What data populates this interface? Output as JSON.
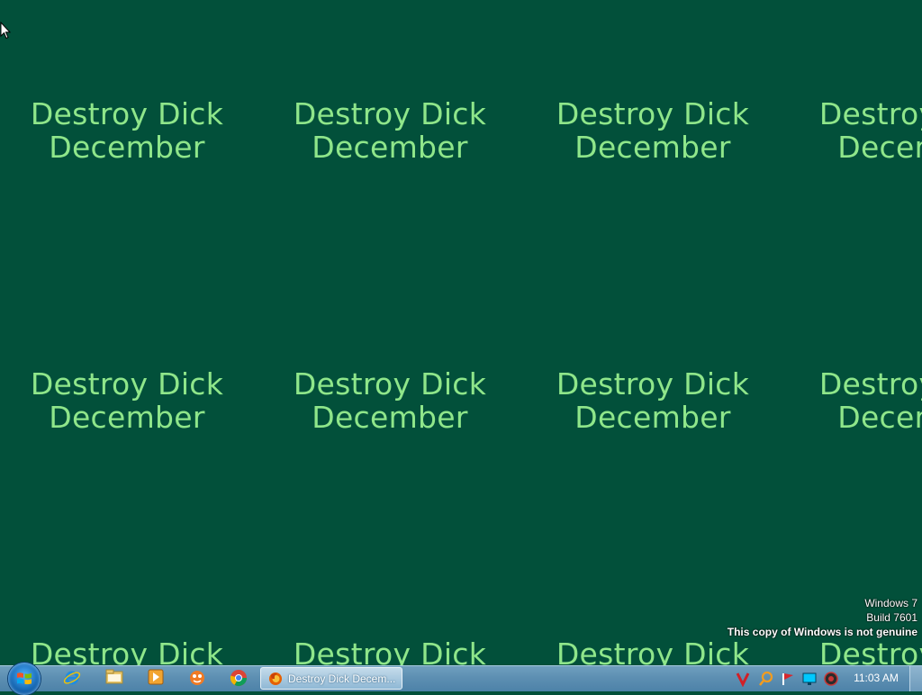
{
  "wallpaper": {
    "line1": "Destroy Dick",
    "line2": "December",
    "background": "#02503a",
    "text_color": "#8fe68a"
  },
  "watermark": {
    "os": "Windows 7",
    "build": "Build 7601",
    "notice": "This copy of Windows is not genuine"
  },
  "taskbar": {
    "pinned": [
      {
        "name": "internet-explorer-icon"
      },
      {
        "name": "windows-explorer-icon"
      },
      {
        "name": "media-player-icon"
      },
      {
        "name": "app-icon"
      },
      {
        "name": "chrome-icon"
      }
    ],
    "active_window": "Destroy Dick Decem...",
    "tray": [
      "antivirus-icon",
      "search-icon",
      "flag-icon",
      "network-icon",
      "volume-icon"
    ],
    "clock": "11:03 AM"
  }
}
